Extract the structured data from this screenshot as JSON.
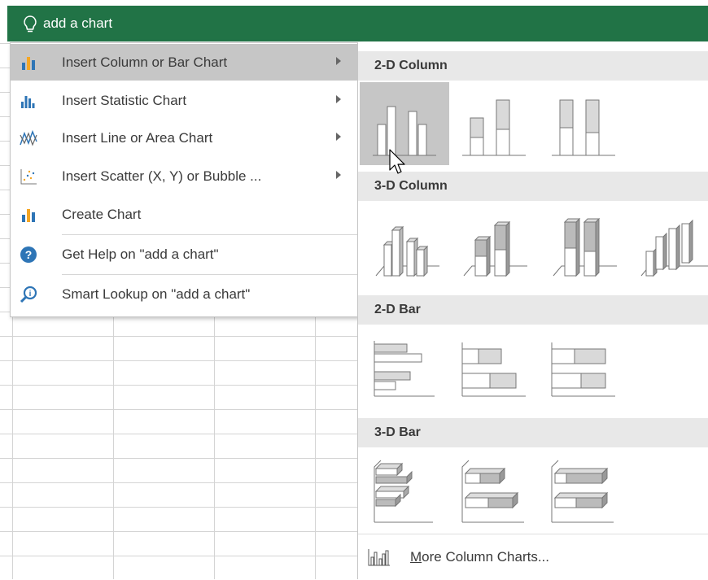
{
  "search": {
    "text": "add a chart"
  },
  "menu": {
    "items": [
      {
        "label": "Insert Column or Bar Chart",
        "icon": "column-chart-icon",
        "submenu": true,
        "active": true
      },
      {
        "label": "Insert Statistic Chart",
        "icon": "statistic-chart-icon",
        "submenu": true
      },
      {
        "label": "Insert Line or Area Chart",
        "icon": "line-chart-icon",
        "submenu": true
      },
      {
        "label": "Insert Scatter (X, Y) or Bubble ...",
        "icon": "scatter-chart-icon",
        "submenu": true
      },
      {
        "label": "Create Chart",
        "icon": "create-chart-icon",
        "submenu": false
      },
      {
        "label": "Get Help on \"add a chart\"",
        "icon": "help-icon",
        "submenu": false
      },
      {
        "label": "Smart Lookup on \"add a chart\"",
        "icon": "smart-lookup-icon",
        "submenu": false
      }
    ]
  },
  "panel": {
    "sections": [
      {
        "title": "2-D Column",
        "charts": [
          "clustered-column-icon",
          "stacked-column-icon",
          "100-stacked-column-icon"
        ]
      },
      {
        "title": "3-D Column",
        "charts": [
          "3d-clustered-column-icon",
          "3d-stacked-column-icon",
          "3d-100-stacked-column-icon",
          "3d-column-icon"
        ]
      },
      {
        "title": "2-D Bar",
        "charts": [
          "clustered-bar-icon",
          "stacked-bar-icon",
          "100-stacked-bar-icon"
        ]
      },
      {
        "title": "3-D Bar",
        "charts": [
          "3d-clustered-bar-icon",
          "3d-stacked-bar-icon",
          "3d-100-stacked-bar-icon"
        ]
      }
    ],
    "more_prefix": "M",
    "more_rest": "ore Column Charts..."
  },
  "colors": {
    "accent_green": "#217346",
    "hover_gray": "#c6c6c6",
    "header_gray": "#e8e8e8",
    "chart_orange": "#f5a623",
    "chart_blue": "#2e75b6"
  }
}
